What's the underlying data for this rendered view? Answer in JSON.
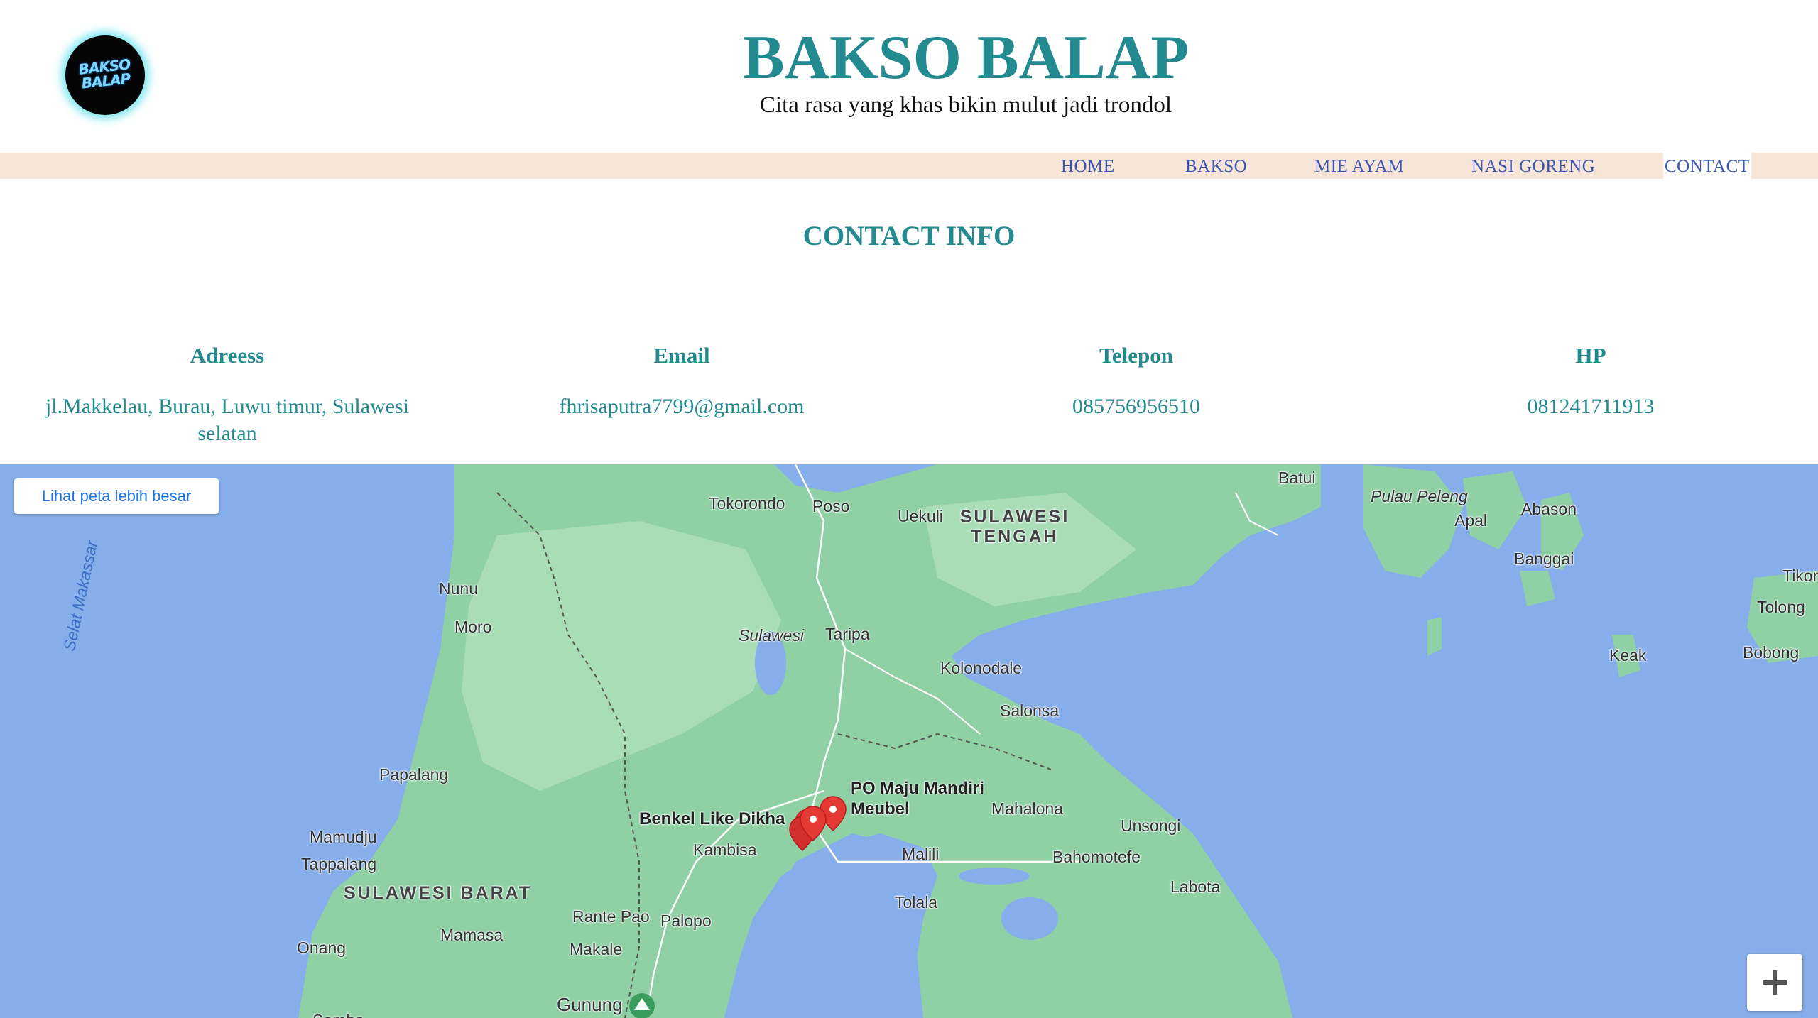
{
  "header": {
    "logo_text": "BAKSO BALAP",
    "title": "BAKSO BALAP",
    "tagline": "Cita rasa yang khas bikin mulut jadi trondol"
  },
  "nav": {
    "items": [
      "HOME",
      "BAKSO",
      "MIE AYAM",
      "NASI GORENG",
      "CONTACT"
    ],
    "active": "CONTACT"
  },
  "contact": {
    "title": "CONTACT INFO",
    "columns": [
      {
        "label": "Adreess",
        "value": "jl.Makkelau, Burau, Luwu timur, Sulawesi selatan"
      },
      {
        "label": "Email",
        "value": "fhrisaputra7799@gmail.com"
      },
      {
        "label": "Telepon",
        "value": "085756956510"
      },
      {
        "label": "HP",
        "value": "081241711913"
      }
    ]
  },
  "map": {
    "larger_map_button": "Lihat peta lebih besar",
    "zoom_in_icon": "plus-icon",
    "colors": {
      "water": "#86aeea",
      "land": "#8fd0a5",
      "marker": "#e53935"
    },
    "labels": {
      "batui": "Batui",
      "pulau_peleng": "Pulau Peleng",
      "abason": "Abason",
      "apal": "Apal",
      "banggai": "Banggai",
      "tikor": "Tikor",
      "tolong": "Tolong",
      "keak": "Keak",
      "bobong": "Bobong",
      "tokorondo": "Tokorondo",
      "poso": "Poso",
      "uekuli": "Uekuli",
      "sulteng": "SULAWESI TENGAH",
      "nunu": "Nunu",
      "moro": "Moro",
      "selat_makassar": "Selat Makassar",
      "sulawesi": "Sulawesi",
      "taripa": "Taripa",
      "kolonodale": "Kolonodale",
      "salonsa": "Salonsa",
      "papalang": "Papalang",
      "po_maju": "PO Maju Mandiri Meubel",
      "benkel": "Benkel Like Dikha",
      "mahalona": "Mahalona",
      "unsongi": "Unsongi",
      "mamudju": "Mamudju",
      "tappalang": "Tappalang",
      "kambisa": "Kambisa",
      "malili": "Malili",
      "bahomotefe": "Bahomotefe",
      "sulbar": "SULAWESI BARAT",
      "labota": "Labota",
      "tolala": "Tolala",
      "rante_pao": "Rante Pao",
      "palopo": "Palopo",
      "mamasa": "Mamasa",
      "onang": "Onang",
      "makale": "Makale",
      "gunung": "Gunung",
      "sombo": "Sombo"
    }
  }
}
